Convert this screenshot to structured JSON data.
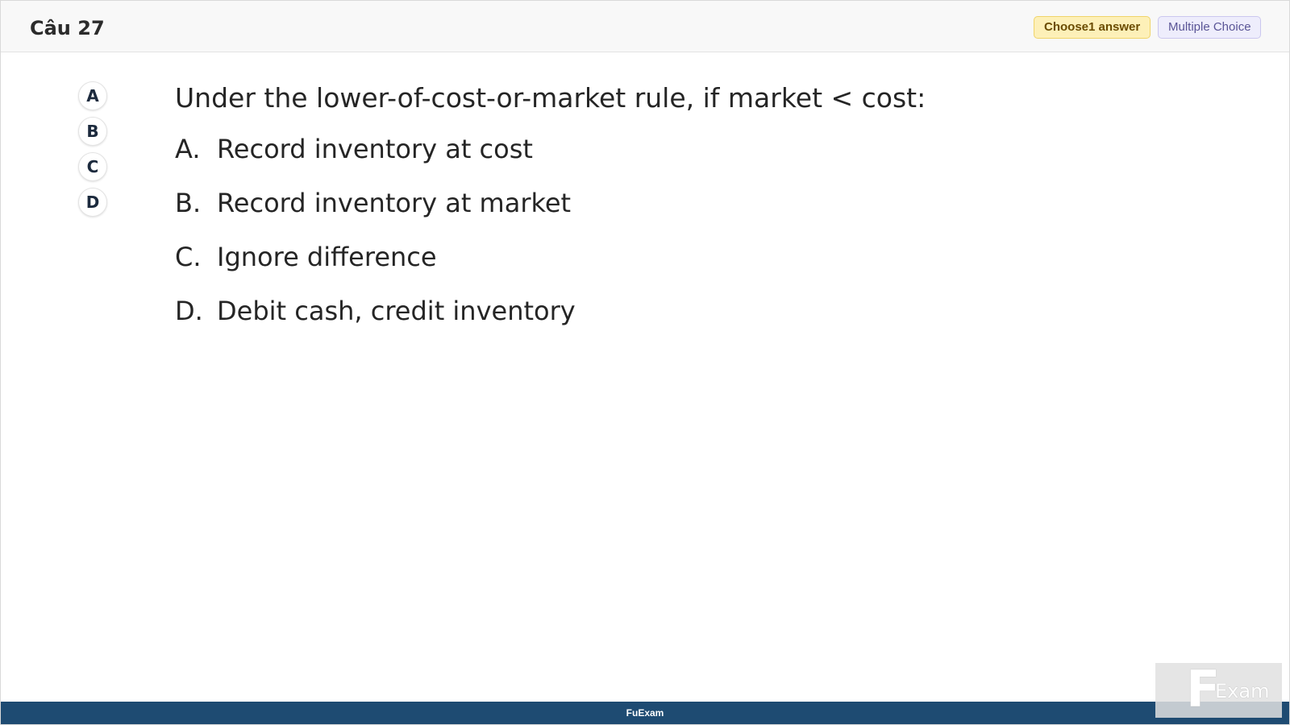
{
  "header": {
    "question_number": "Câu 27",
    "choose_badge": "Choose1 answer",
    "type_badge": "Multiple Choice"
  },
  "letters": [
    "A",
    "B",
    "C",
    "D"
  ],
  "question": {
    "text": "Under the lower-of-cost-or-market rule, if market < cost:",
    "options": [
      {
        "label": "A.",
        "text": "Record inventory at cost"
      },
      {
        "label": "B.",
        "text": "Record inventory at market"
      },
      {
        "label": "C.",
        "text": "Ignore difference"
      },
      {
        "label": "D.",
        "text": "Debit cash, credit inventory"
      }
    ]
  },
  "footer": {
    "brand": "FuExam"
  },
  "watermark": {
    "letter": "F",
    "word": "Exam"
  },
  "colors": {
    "footer_bg": "#1e4b72",
    "choose_badge_bg": "#fdf0b8",
    "type_badge_bg": "#eeedfc"
  }
}
